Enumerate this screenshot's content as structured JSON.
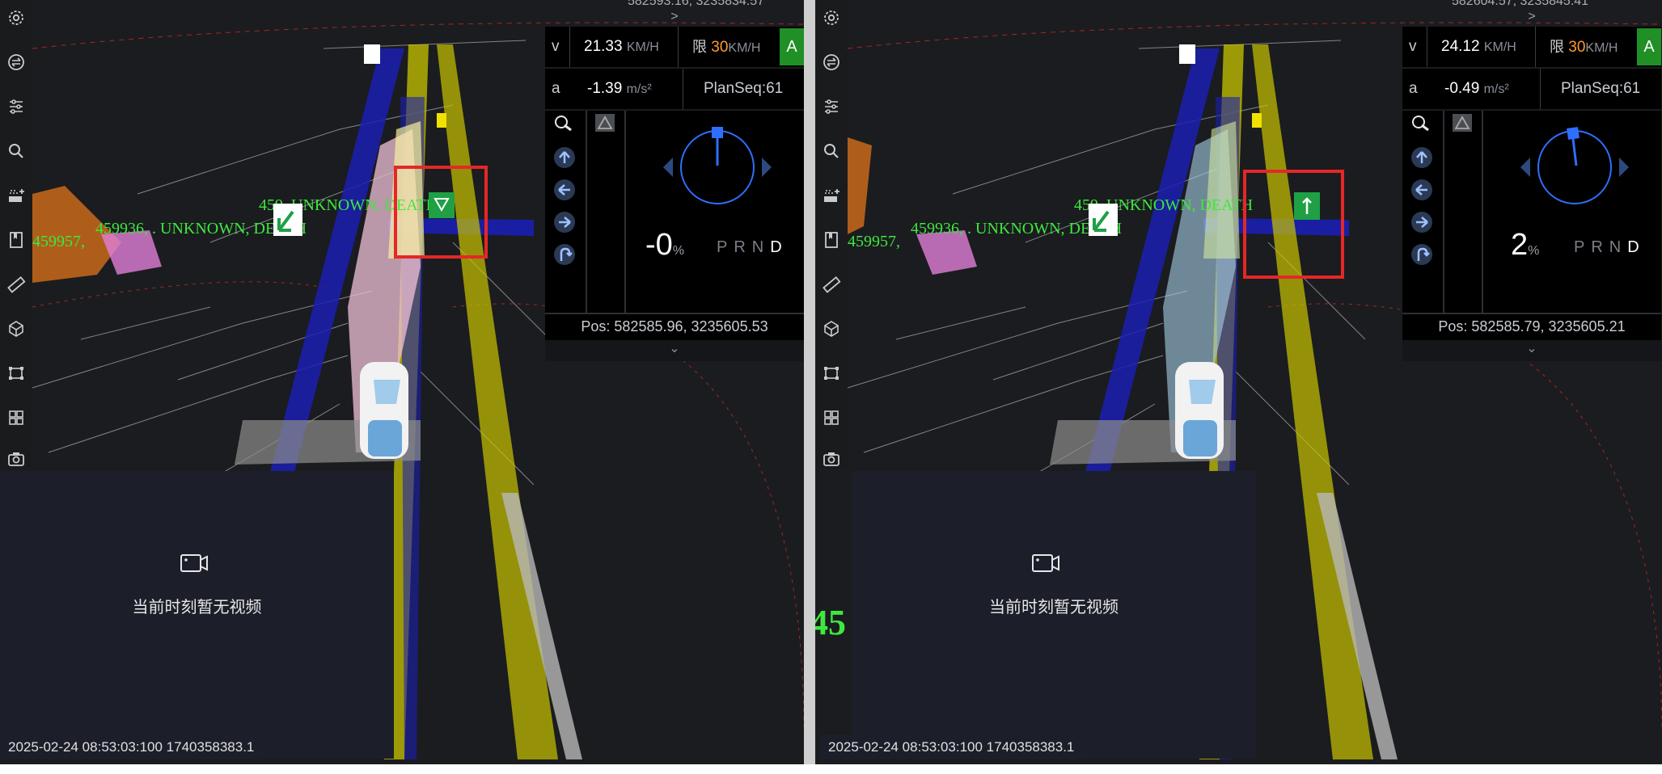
{
  "panels": [
    {
      "top_coord": "582593.16, 3235834.57",
      "hud": {
        "toggle_top": ">",
        "speed_label": "v",
        "speed_value": "21.33",
        "speed_unit": "KM/H",
        "limit_label": "限",
        "limit_value": "30",
        "limit_unit": "KM/H",
        "mode_badge": "A",
        "accel_label": "a",
        "accel_value": "-1.39",
        "accel_unit": "m/s²",
        "plan_seq": "PlanSeq:61",
        "percent_value": "-0",
        "percent_unit": "%",
        "gears": [
          "P",
          "R",
          "N",
          "D"
        ],
        "active_gear": "D",
        "position": "Pos: 582585.96, 3235605.53",
        "toggle_bottom": "⌄"
      },
      "scene_labels": {
        "label_a": "459936, . UNKNOWN, DEATH",
        "label_b": "459957,",
        "label_c": "459, UNKNOWN, DEATH",
        "label_d": "45",
        "label_e": "UNKNOWN, DEATH"
      },
      "video": {
        "message": "当前时刻暂无视频"
      },
      "timestamp": "2025-02-24 08:53:03:100 1740358383.1"
    },
    {
      "top_coord": "582604.57, 3235845.41",
      "hud": {
        "toggle_top": ">",
        "speed_label": "v",
        "speed_value": "24.12",
        "speed_unit": "KM/H",
        "limit_label": "限",
        "limit_value": "30",
        "limit_unit": "KM/H",
        "mode_badge": "A",
        "accel_label": "a",
        "accel_value": "-0.49",
        "accel_unit": "m/s²",
        "plan_seq": "PlanSeq:61",
        "percent_value": "2",
        "percent_unit": "%",
        "gears": [
          "P",
          "R",
          "N",
          "D"
        ],
        "active_gear": "D",
        "position": "Pos: 582585.79, 3235605.21",
        "toggle_bottom": "⌄"
      },
      "scene_labels": {
        "label_a": "459936, . UNKNOWN, DEATH",
        "label_b": "459957,",
        "label_c": "459, UNKNOWN, DEATH",
        "label_d": "45",
        "label_e": "UNKNOWN, DEATH"
      },
      "video": {
        "message": "当前时刻暂无视频"
      },
      "timestamp": "2025-02-24 08:53:03:100 1740358383.1"
    }
  ],
  "sidebar_icons": [
    "settings-icon",
    "swap-icon",
    "sliders-icon",
    "search-icon",
    "layers-plus-icon",
    "book-icon",
    "ruler-icon",
    "cube-icon",
    "bounding-box-icon",
    "grid-icon",
    "camera-icon"
  ],
  "colors": {
    "background": "#1b1c1f",
    "hud_bg": "#000000",
    "accent_green": "#1f8f26",
    "limit_orange": "#ff9a2e",
    "highlight_red": "#e52727",
    "lane_blue": "#1a1fb0",
    "lane_yellow": "#c9c400",
    "compass_blue": "#2f6fff"
  }
}
